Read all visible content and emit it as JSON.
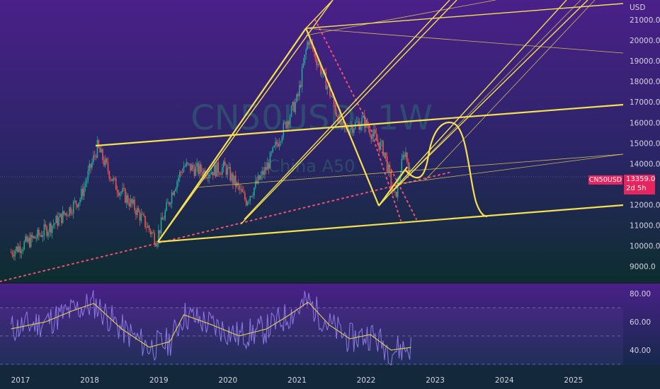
{
  "watermark": {
    "symbol": "CN50USD",
    "interval": "1W",
    "description": "China A50"
  },
  "price_axis": {
    "unit": "USD",
    "ticks": [
      "21000.0",
      "20000.0",
      "19000.0",
      "18000.0",
      "17000.0",
      "16000.0",
      "15000.0",
      "14000.0",
      "12000.0",
      "11000.0",
      "10000.0",
      "9000.0"
    ],
    "tick_values": [
      21000,
      20000,
      19000,
      18000,
      17000,
      16000,
      15000,
      14000,
      12000,
      11000,
      10000,
      9000
    ]
  },
  "last_price": {
    "symbol": "CN50USD",
    "value": "13359.0",
    "countdown": "2d 5h"
  },
  "rsi_axis": {
    "ticks": [
      "80.00",
      "60.00",
      "40.00"
    ],
    "tick_values": [
      80,
      60,
      40
    ]
  },
  "time_axis": {
    "labels": [
      "2017",
      "2018",
      "2019",
      "2020",
      "2021",
      "2022",
      "2023",
      "2024",
      "2025"
    ],
    "years": [
      2017,
      2018,
      2019,
      2020,
      2021,
      2022,
      2023,
      2024,
      2025
    ]
  },
  "colors": {
    "up": "#26a69a",
    "down": "#ef5350",
    "drawing": "#f5e050",
    "dotted": "#f0506e",
    "rsi": "#8c7ae6",
    "rsi_ma": "#e8d24a",
    "badge": "#e8245e"
  },
  "chart_data": [
    {
      "type": "candlestick",
      "title": "CN50USD, 1W",
      "unit": "USD",
      "x_range": [
        2016.8,
        2025.8
      ],
      "y_range": [
        8600,
        21900
      ],
      "last_value": 13359,
      "approx_close_path": [
        [
          2016.8,
          9700
        ],
        [
          2017.2,
          10500
        ],
        [
          2017.5,
          11300
        ],
        [
          2017.8,
          12300
        ],
        [
          2018.05,
          14800
        ],
        [
          2018.3,
          13000
        ],
        [
          2018.6,
          11800
        ],
        [
          2018.9,
          10300
        ],
        [
          2019.15,
          12800
        ],
        [
          2019.3,
          13900
        ],
        [
          2019.6,
          13600
        ],
        [
          2019.9,
          13800
        ],
        [
          2020.2,
          12200
        ],
        [
          2020.5,
          13800
        ],
        [
          2020.7,
          15400
        ],
        [
          2020.95,
          17200
        ],
        [
          2021.1,
          20100
        ],
        [
          2021.4,
          17600
        ],
        [
          2021.6,
          15600
        ],
        [
          2021.9,
          16100
        ],
        [
          2022.2,
          14600
        ],
        [
          2022.35,
          12200
        ],
        [
          2022.5,
          14700
        ],
        [
          2022.58,
          13359
        ]
      ]
    },
    {
      "type": "line",
      "title": "RSI",
      "y_range": [
        25,
        86
      ],
      "levels": [
        70,
        50,
        30
      ],
      "approx_rsi_ma": [
        [
          2016.8,
          55
        ],
        [
          2017.3,
          60
        ],
        [
          2017.7,
          68
        ],
        [
          2018.0,
          73
        ],
        [
          2018.4,
          55
        ],
        [
          2018.8,
          42
        ],
        [
          2019.1,
          46
        ],
        [
          2019.3,
          65
        ],
        [
          2019.7,
          58
        ],
        [
          2020.1,
          50
        ],
        [
          2020.5,
          55
        ],
        [
          2020.8,
          64
        ],
        [
          2021.1,
          74
        ],
        [
          2021.4,
          58
        ],
        [
          2021.7,
          48
        ],
        [
          2022.0,
          51
        ],
        [
          2022.3,
          40
        ],
        [
          2022.6,
          42
        ]
      ]
    }
  ]
}
